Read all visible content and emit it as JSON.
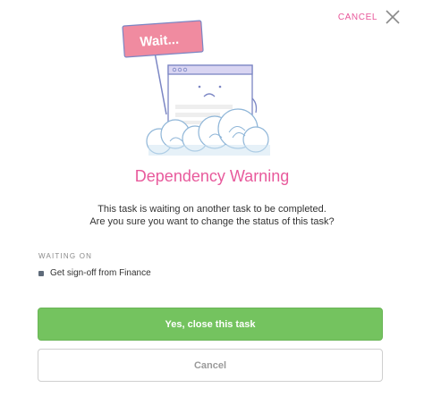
{
  "header": {
    "cancel_label": "CANCEL"
  },
  "illustration": {
    "sign_text": "Wait...",
    "icon": "waiting-browser-illustration"
  },
  "dialog": {
    "title": "Dependency Warning",
    "message_line_1": "This task is waiting on another task to be completed.",
    "message_line_2": "Are you sure you want to change the status of this task?"
  },
  "waiting_on": {
    "label": "WAITING ON",
    "items": [
      {
        "label": "Get sign-off from Finance"
      }
    ]
  },
  "actions": {
    "confirm_label": "Yes, close this task",
    "cancel_label": "Cancel"
  },
  "colors": {
    "accent_pink": "#e85a9c",
    "confirm_green": "#74c35f",
    "cloud_blue": "#cde3f2",
    "sign_pink": "#f08ba0",
    "window_purple": "#d9d5f2"
  }
}
